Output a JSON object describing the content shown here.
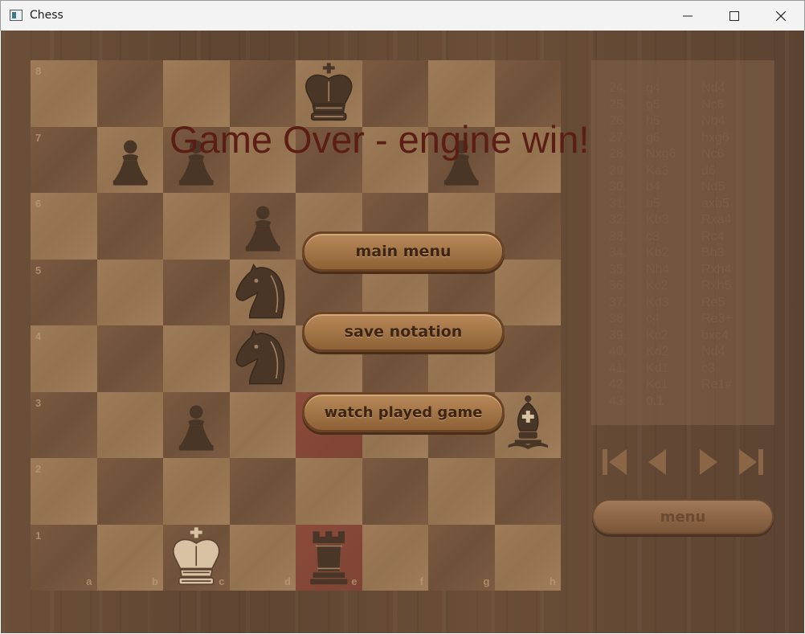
{
  "window": {
    "title": "Chess"
  },
  "board": {
    "files": [
      "a",
      "b",
      "c",
      "d",
      "e",
      "f",
      "g",
      "h"
    ],
    "ranks": [
      "8",
      "7",
      "6",
      "5",
      "4",
      "3",
      "2",
      "1"
    ],
    "highlighted_squares": [
      "e3",
      "e1"
    ],
    "pieces": [
      {
        "square": "e8",
        "piece": "king",
        "color": "black"
      },
      {
        "square": "b7",
        "piece": "pawn",
        "color": "black"
      },
      {
        "square": "c7",
        "piece": "pawn",
        "color": "black"
      },
      {
        "square": "g7",
        "piece": "pawn",
        "color": "black"
      },
      {
        "square": "d6",
        "piece": "pawn",
        "color": "black"
      },
      {
        "square": "d5",
        "piece": "knight",
        "color": "black"
      },
      {
        "square": "d4",
        "piece": "knight",
        "color": "black"
      },
      {
        "square": "c3",
        "piece": "pawn",
        "color": "black"
      },
      {
        "square": "h3",
        "piece": "bishop",
        "color": "black"
      },
      {
        "square": "c1",
        "piece": "king",
        "color": "white"
      },
      {
        "square": "e1",
        "piece": "rook",
        "color": "black"
      }
    ]
  },
  "overlay": {
    "message": "Game Over - engine win!",
    "buttons": {
      "main_menu": "main menu",
      "save_notation": "save notation",
      "watch_played_game": "watch played game"
    }
  },
  "notation": {
    "moves": [
      {
        "no": "24.",
        "white": "g4",
        "black": "Nd4"
      },
      {
        "no": "25.",
        "white": "g5",
        "black": "Nc6"
      },
      {
        "no": "26.",
        "white": "h5",
        "black": "Nb4"
      },
      {
        "no": "27.",
        "white": "g6",
        "black": "hxg6"
      },
      {
        "no": "28.",
        "white": "Nxg6",
        "black": "Nc6"
      },
      {
        "no": "29.",
        "white": "Ka3",
        "black": "d6"
      },
      {
        "no": "30.",
        "white": "b4",
        "black": "Nd5"
      },
      {
        "no": "31.",
        "white": "b5",
        "black": "axb5"
      },
      {
        "no": "32.",
        "white": "Kb3",
        "black": "Rxa4"
      },
      {
        "no": "33.",
        "white": "c3",
        "black": "Rc4"
      },
      {
        "no": "34.",
        "white": "Kb2",
        "black": "Bh3"
      },
      {
        "no": "35.",
        "white": "Nh4",
        "black": "Rxh4"
      },
      {
        "no": "36.",
        "white": "Kc2",
        "black": "Rxh5"
      },
      {
        "no": "37.",
        "white": "Kd3",
        "black": "Re5"
      },
      {
        "no": "38.",
        "white": "c4",
        "black": "Re3+"
      },
      {
        "no": "39.",
        "white": "Kc2",
        "black": "bxc4"
      },
      {
        "no": "40.",
        "white": "Kd2",
        "black": "Nd4"
      },
      {
        "no": "41.",
        "white": "Kd1",
        "black": "c3"
      },
      {
        "no": "42.",
        "white": "Kc1",
        "black": "Re1#"
      },
      {
        "no": "43.",
        "white": "0.1",
        "black": ""
      }
    ]
  },
  "controls": {
    "nav_icons": [
      "first-move-icon",
      "previous-move-icon",
      "next-move-icon",
      "last-move-icon"
    ],
    "menu_label": "menu"
  }
}
